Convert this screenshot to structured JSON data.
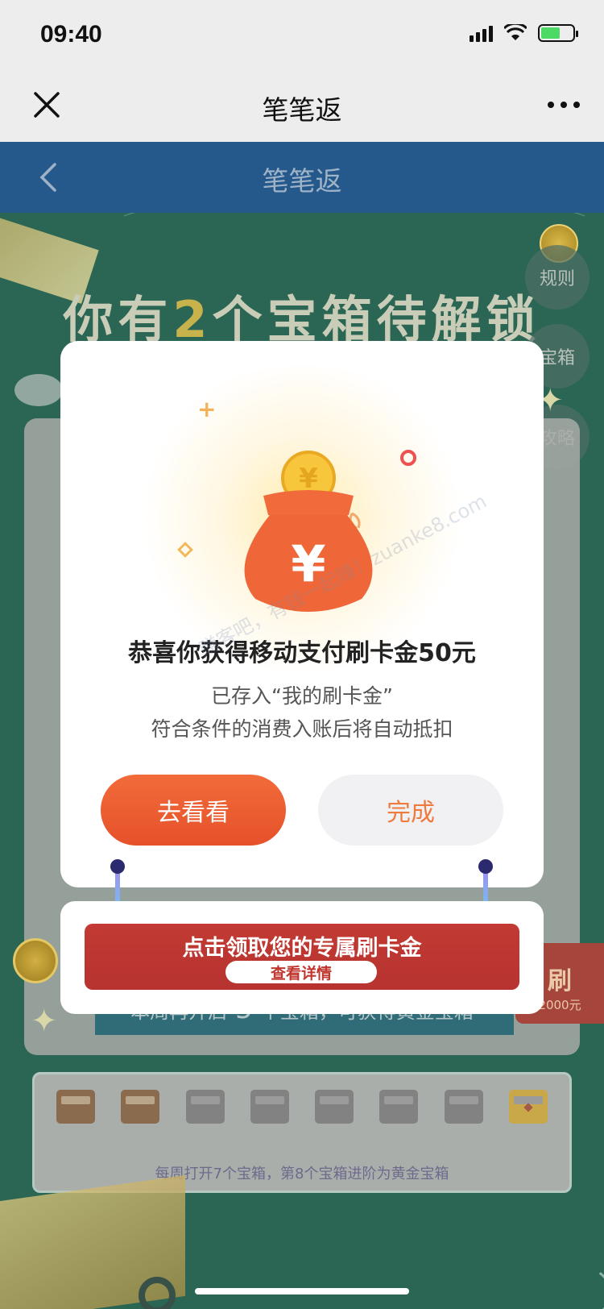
{
  "status_bar": {
    "time": "09:40"
  },
  "wechat_bar": {
    "title": "笔笔返"
  },
  "app_bar": {
    "title": "笔笔返"
  },
  "page": {
    "headline_pre": "你有",
    "headline_num": "2",
    "headline_post": "个宝箱待解锁",
    "side_buttons": [
      "规则",
      "宝箱",
      "攻略"
    ],
    "promo_label": "刷",
    "promo_amount": "2000元",
    "week_text_pre": "本周再开启",
    "week_count": "5",
    "week_text_post": "个宝箱，可获得黄金宝箱",
    "chests": [
      "opened",
      "opened",
      "locked",
      "locked",
      "locked",
      "locked",
      "locked",
      "gold"
    ],
    "chest_hint": "每周打开7个宝箱，第8个宝箱进阶为黄金宝箱"
  },
  "modal": {
    "title": "恭喜你获得移动支付刷卡金50元",
    "line1": "已存入“我的刷卡金”",
    "line2": "符合条件的消费入账后将自动抵扣",
    "btn_go": "去看看",
    "btn_done": "完成"
  },
  "banner": {
    "title": "点击领取您的专属刷卡金",
    "button": "查看详情"
  },
  "watermark": "赚客吧，有钱一起赚！zuanke8.com",
  "colors": {
    "accent": "#e6512a",
    "nav": "#25598c",
    "banner": "#c23a33"
  }
}
